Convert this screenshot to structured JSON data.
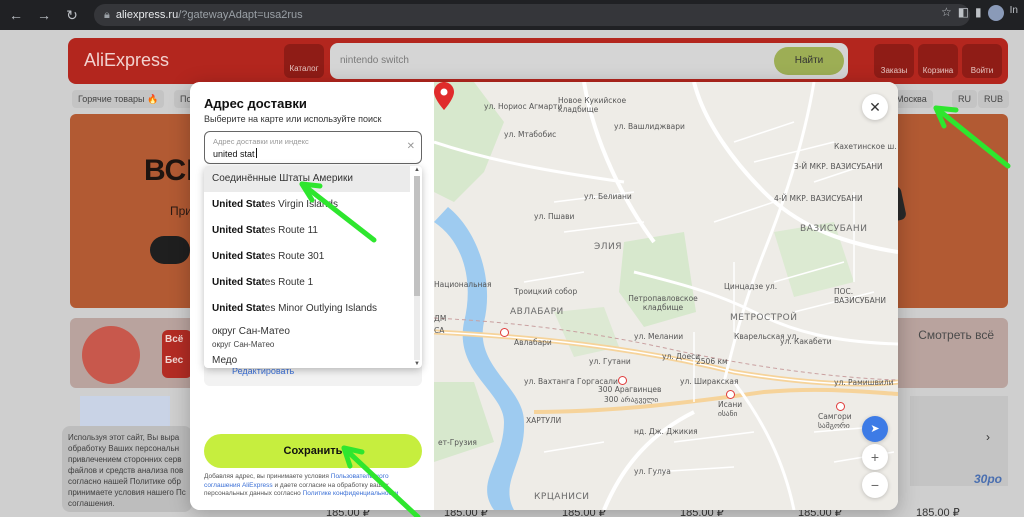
{
  "browser": {
    "url_host": "aliexpress.ru",
    "url_path": "/?gatewayAdapt=usa2rus",
    "profile_initial": "In"
  },
  "page": {
    "logo": "AliExpress",
    "catalog_label": "Каталог",
    "search_placeholder": "nintendo switch",
    "search_button": "Найти",
    "orders_label": "Заказы",
    "cart_label": "Корзина",
    "login_label": "Войти",
    "hot_goods": "Горячие товары 🔥",
    "subnav_more": "По",
    "city": "Москва",
    "lang": "RU",
    "currency": "RUB",
    "banner_text": "ВСЁ",
    "banner_sub": "Прим",
    "banner_price": "185 ₽",
    "promo_text_1": "Всё",
    "promo_text_2": "Бес",
    "see_all": "Смотреть всё",
    "cookie_text": "Используя этот сайт, Вы выра обработку Ваших персональн привлечением сторонних серв файлов и средств анализа пов согласно нашей Политике обр принимаете условия нашего Пс соглашения.",
    "prices": [
      "185.00 ₽",
      "185.00 ₽",
      "185.00 ₽",
      "185.00 ₽",
      "185.00 ₽",
      "185.00 ₽"
    ],
    "promo_small_price": "30ро"
  },
  "modal": {
    "title": "Адрес доставки",
    "subtitle": "Выберите на карте или используйте поиск",
    "field_label": "Адрес доставки или индекс",
    "field_value": "united stat",
    "suggestions": [
      {
        "bold": "",
        "rest": "Соединённые Штаты Америки",
        "sub": ""
      },
      {
        "bold": "United Stat",
        "rest": "es Virgin Islands",
        "sub": ""
      },
      {
        "bold": "United Stat",
        "rest": "es Route 11",
        "sub": ""
      },
      {
        "bold": "United Stat",
        "rest": "es Route 301",
        "sub": ""
      },
      {
        "bold": "United Stat",
        "rest": "es Route 1",
        "sub": ""
      },
      {
        "bold": "United Stat",
        "rest": "es Minor Outlying Islands",
        "sub": ""
      },
      {
        "bold": "",
        "rest": "округ Сан-Матео",
        "sub": "округ Сан-Матео"
      },
      {
        "bold": "",
        "rest": "Медо",
        "sub": ""
      }
    ],
    "behind_link": "Редактировать",
    "save_button": "Сохранить",
    "legal_1": "Добавляя адрес, вы принимаете условия ",
    "legal_link_1": "Пользовательского соглашения AliExpress",
    "legal_2": " и даете согласие на обработку ваших персональных данных согласно ",
    "legal_link_2": "Политике конфиденциальности"
  },
  "map": {
    "labels": {
      "norios": "ул. Нориос Агмарти",
      "kukia": "Новое Кукийское кладбище",
      "mtatsminda": "ул. Мтабобис",
      "vashlijvari": "ул. Вашлиджвари",
      "pshavi": "ул. Пшави",
      "beliani": "ул. Белиани",
      "elia": "ЭЛИЯ",
      "trinity": "Троицкий собор",
      "petropavlov": "Петропавловское кладбище",
      "vazisubani": "ВАЗИСУБАНИ",
      "mkr3": "3-Й МКР. ВАЗИСУБАНИ",
      "mkr4": "4-Й МКР. ВАЗИСУБАНИ",
      "avlabari_area": "АВЛАБАРИ",
      "avlabari": "Авлабари",
      "metrostroy": "МЕТРОСТРОЙ",
      "gutani": "ул. Гутани",
      "doesi": "ул. Доеси",
      "melanii": "ул. Мелании",
      "km2506": "2506 км",
      "shirakskaya": "ул. Ширакская",
      "vakhtanga": "ул. Вахтанга Горгасали",
      "aragvintsev": "300 Арагвинцев",
      "aragvintsev_ka": "300 არაგველი",
      "isani": "Исани",
      "isani_ka": "ისანი",
      "samgori": "Самгори",
      "samgori_ka": "სამგორი",
      "kartuli": "ХАРТУЛИ",
      "metekhi": "ет-Грузия",
      "jikia": "ул. Джикия",
      "gulua": "ул. Гулуа",
      "krtsanisi": "КРЦАНИСИ",
      "ramishvili": "ул. Рамишвили",
      "kakhetian": "Кахетинское ш.",
      "ts_vazis": "ПОС. ВАЗИСУБАНИ",
      "tsin": "Цинцадзе ул.",
      "kvarelskaya": "Кварельская ул.",
      "kakabeti": "ул. Какабети",
      "dzhikia": "нд. Дж. Джикия",
      "national": "Национальная",
      "sa": "СА",
      "dm": "ДМ"
    }
  },
  "colors": {
    "accent_lime": "#c6ee3e",
    "link_blue": "#3a6fd6",
    "pin_red": "#e02b2b",
    "annotation_green": "#2ee62e"
  }
}
